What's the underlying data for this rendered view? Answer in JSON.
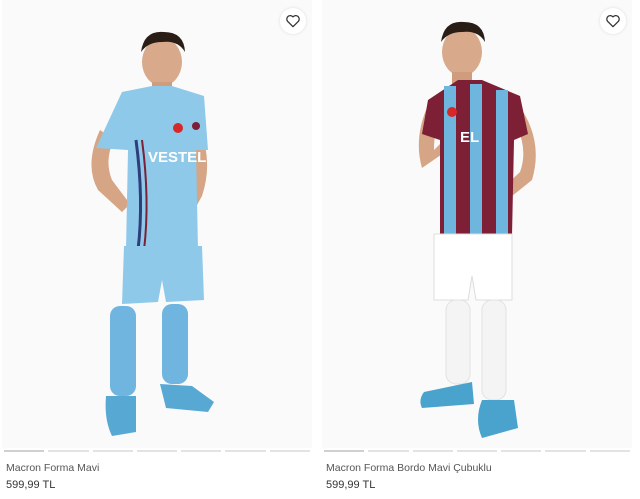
{
  "products": [
    {
      "name": "Macron Forma Mavi",
      "price": "599,99 TL",
      "jersey_text": "VESTEL",
      "favorite_icon": "heart-outline-icon",
      "colors": {
        "shirt": "#8ec9ea",
        "shorts": "#8ec9ea",
        "socks": "#6fb5df",
        "boots": "#57a9d4"
      }
    },
    {
      "name": "Macron Forma Bordo Mavi Çubuklu",
      "price": "599,99 TL",
      "jersey_text": "EL",
      "favorite_icon": "heart-outline-icon",
      "colors": {
        "shirt_a": "#7d1f35",
        "shirt_b": "#6fb6df",
        "shorts": "#ffffff",
        "socks": "#f4f4f4",
        "boots": "#4aa3cc"
      }
    }
  ]
}
